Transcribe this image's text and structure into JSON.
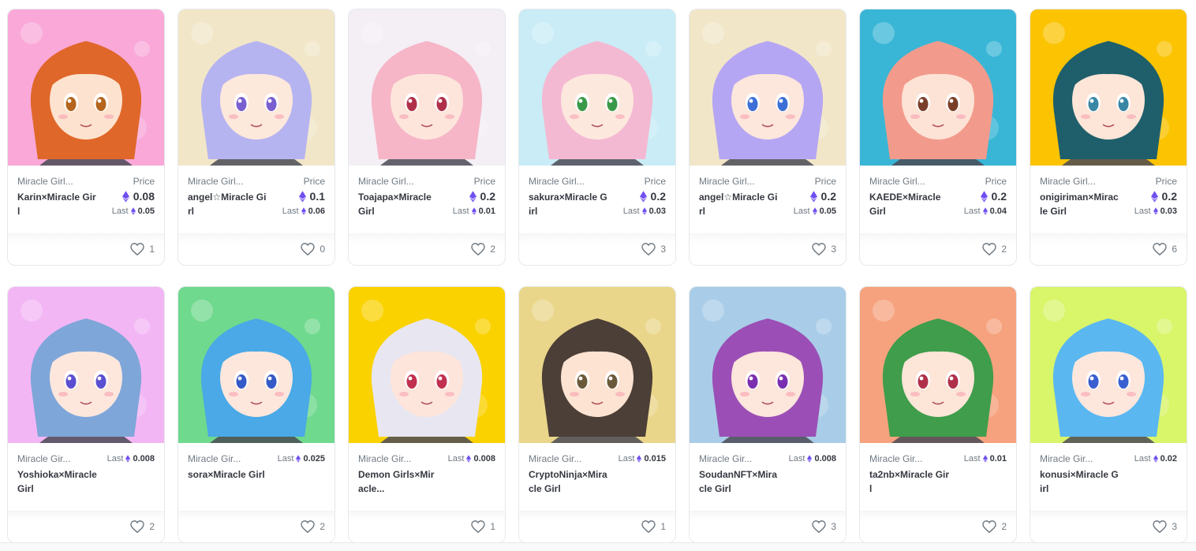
{
  "cards": [
    {
      "collection": "Miracle Girl...",
      "name": "Karin×Miracle Girl",
      "price_label": "Price",
      "price": "0.08",
      "last_label": "Last",
      "last": "0.05",
      "likes": "1",
      "bg": "#f9a8d8",
      "hair": "#e0672a",
      "skin": "#fde3cf",
      "eyes": "#b5651d"
    },
    {
      "collection": "Miracle Girl...",
      "name": "angel☆Miracle Girl",
      "price_label": "Price",
      "price": "0.1",
      "last_label": "Last",
      "last": "0.06",
      "likes": "0",
      "bg": "#f2e6c8",
      "hair": "#b6b4f0",
      "skin": "#fde8dc",
      "eyes": "#7a5fd1"
    },
    {
      "collection": "Miracle Girl...",
      "name": "Toajapa×Miracle Girl",
      "price_label": "Price",
      "price": "0.2",
      "last_label": "Last",
      "last": "0.01",
      "likes": "2",
      "bg": "#f4eef5",
      "hair": "#f6b6c7",
      "skin": "#fde5db",
      "eyes": "#b0304a"
    },
    {
      "collection": "Miracle Girl...",
      "name": "sakura×Miracle Girl",
      "price_label": "Price",
      "price": "0.2",
      "last_label": "Last",
      "last": "0.03",
      "likes": "3",
      "bg": "#c9ecf6",
      "hair": "#f4b9d2",
      "skin": "#fde8de",
      "eyes": "#3b9a4a"
    },
    {
      "collection": "Miracle Girl...",
      "name": "angel☆Miracle Girl",
      "price_label": "Price",
      "price": "0.2",
      "last_label": "Last",
      "last": "0.05",
      "likes": "3",
      "bg": "#f2e6c8",
      "hair": "#b5a6f3",
      "skin": "#fde6dc",
      "eyes": "#3d6fd6"
    },
    {
      "collection": "Miracle Girl...",
      "name": "KAEDE×Miracle Girl",
      "price_label": "Price",
      "price": "0.2",
      "last_label": "Last",
      "last": "0.04",
      "likes": "2",
      "bg": "#39b6d6",
      "hair": "#f29b8c",
      "skin": "#fde3d6",
      "eyes": "#7a3f2a"
    },
    {
      "collection": "Miracle Girl...",
      "name": "onigiriman×Miracle Girl",
      "price_label": "Price",
      "price": "0.2",
      "last_label": "Last",
      "last": "0.03",
      "likes": "6",
      "bg": "#fbc301",
      "hair": "#1f5f6b",
      "skin": "#fde5d8",
      "eyes": "#3a86a5"
    },
    {
      "collection": "Miracle Gir...",
      "name": "Yoshioka×Miracle Girl",
      "last_label": "Last",
      "last": "0.008",
      "likes": "2",
      "bg": "#f3b6f5",
      "hair": "#7fa6d9",
      "skin": "#fde7dd",
      "eyes": "#5a4fd1"
    },
    {
      "collection": "Miracle Gir...",
      "name": "sora×Miracle Girl",
      "last_label": "Last",
      "last": "0.025",
      "likes": "2",
      "bg": "#6fd98e",
      "hair": "#4aa9e6",
      "skin": "#fde7dd",
      "eyes": "#3559c7"
    },
    {
      "collection": "Miracle Gir...",
      "name": "Demon Girls×Miracle...",
      "last_label": "Last",
      "last": "0.008",
      "likes": "1",
      "bg": "#fad200",
      "hair": "#e8e6f0",
      "skin": "#fde5dc",
      "eyes": "#c2304f"
    },
    {
      "collection": "Miracle Gir...",
      "name": "CryptoNinja×Miracle Girl",
      "last_label": "Last",
      "last": "0.015",
      "likes": "1",
      "bg": "#ead68a",
      "hair": "#4b3f37",
      "skin": "#fde3d2",
      "eyes": "#6b5a3a"
    },
    {
      "collection": "Miracle Gir...",
      "name": "SoudanNFT×Miracle Girl",
      "last_label": "Last",
      "last": "0.008",
      "likes": "3",
      "bg": "#a9cde8",
      "hair": "#9b4fb6",
      "skin": "#fde6dc",
      "eyes": "#7a2fb0"
    },
    {
      "collection": "Miracle Gir...",
      "name": "ta2nb×Miracle Girl",
      "last_label": "Last",
      "last": "0.01",
      "likes": "2",
      "bg": "#f6a27e",
      "hair": "#3f9d4b",
      "skin": "#fde5d8",
      "eyes": "#b0304a"
    },
    {
      "collection": "Miracle Gir...",
      "name": "konusi×Miracle Girl",
      "last_label": "Last",
      "last": "0.02",
      "likes": "3",
      "bg": "#d9f56a",
      "hair": "#5bb7f0",
      "skin": "#fde7dd",
      "eyes": "#3a5fd0"
    }
  ],
  "colors": {
    "eth": "#6f4ef2",
    "muted": "#707a83",
    "text": "#353840"
  },
  "icons": {
    "currency": "ethereum-icon",
    "like": "heart-icon"
  }
}
